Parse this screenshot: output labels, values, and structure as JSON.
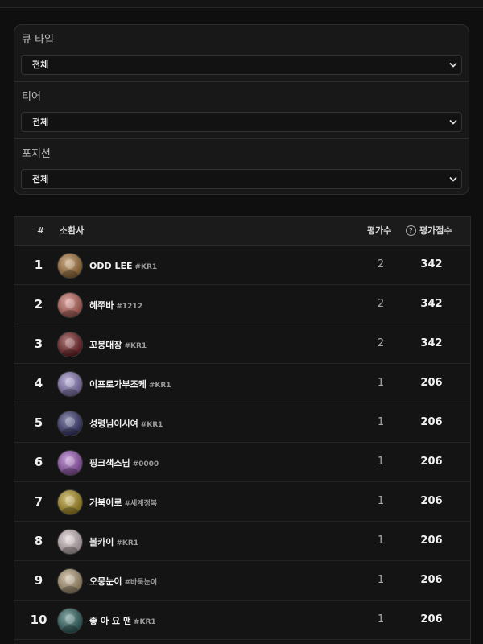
{
  "filters": [
    {
      "label": "큐 타입",
      "selected": "전체"
    },
    {
      "label": "티어",
      "selected": "전체"
    },
    {
      "label": "포지션",
      "selected": "전체"
    }
  ],
  "table": {
    "headers": {
      "rank": "#",
      "summoner": "소환사",
      "count": "평가수",
      "score": "평가점수"
    },
    "rows": [
      {
        "rank": "1",
        "name": "ODD LEE",
        "tag": "#KR1",
        "count": "2",
        "score": "342",
        "avatar_color": "#b07a3a"
      },
      {
        "rank": "2",
        "name": "혜쭈바",
        "tag": "#1212",
        "count": "2",
        "score": "342",
        "avatar_color": "#c9685e"
      },
      {
        "rank": "3",
        "name": "꼬붕대장",
        "tag": "#KR1",
        "count": "2",
        "score": "342",
        "avatar_color": "#7a1e22"
      },
      {
        "rank": "4",
        "name": "이프로가부조케",
        "tag": "#KR1",
        "count": "1",
        "score": "206",
        "avatar_color": "#8f7fc2"
      },
      {
        "rank": "5",
        "name": "성령님이시여",
        "tag": "#KR1",
        "count": "1",
        "score": "206",
        "avatar_color": "#3b3a78"
      },
      {
        "rank": "6",
        "name": "핑크색스님",
        "tag": "#0000",
        "count": "1",
        "score": "206",
        "avatar_color": "#a25cc2"
      },
      {
        "rank": "7",
        "name": "거북이로",
        "tag": "#세계정복",
        "count": "1",
        "score": "206",
        "avatar_color": "#b89a1f"
      },
      {
        "rank": "8",
        "name": "볼카이",
        "tag": "#KR1",
        "count": "1",
        "score": "206",
        "avatar_color": "#d7c4c8"
      },
      {
        "rank": "9",
        "name": "오뭉눈이",
        "tag": "#바둑눈이",
        "count": "1",
        "score": "206",
        "avatar_color": "#b9a27a"
      },
      {
        "rank": "10",
        "name": "좋 아 요 맨",
        "tag": "#KR1",
        "count": "1",
        "score": "206",
        "avatar_color": "#2f6a66"
      }
    ]
  },
  "icons": {
    "select": "chevron-down-icon",
    "help": "question-circle-icon"
  }
}
